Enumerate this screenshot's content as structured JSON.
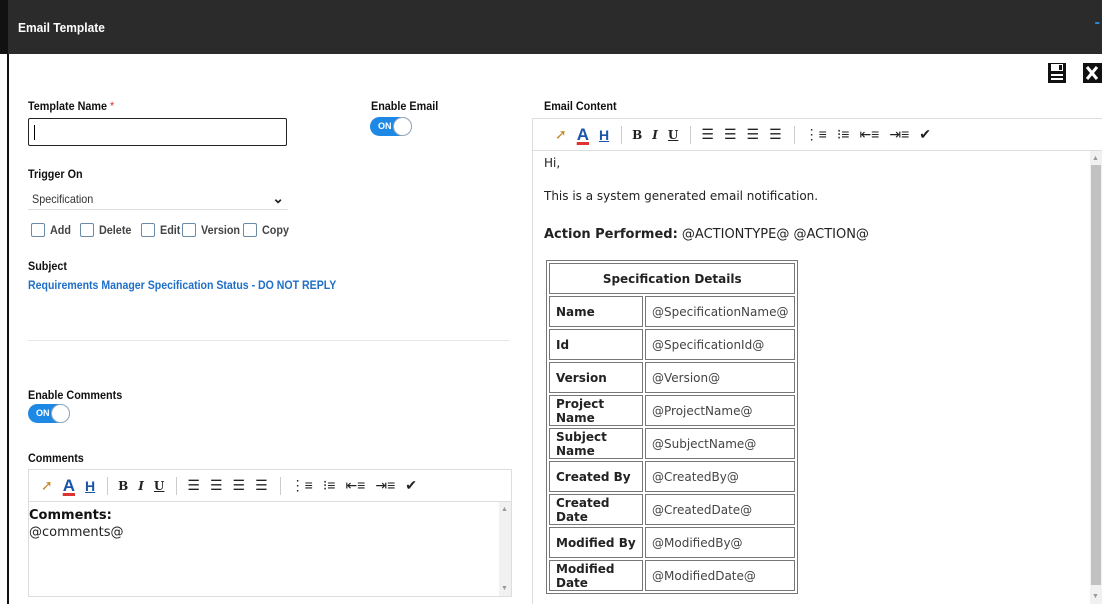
{
  "window": {
    "title": "Email Template",
    "minimize_glyph": "-"
  },
  "toolbar": {
    "save_icon": "save-icon",
    "close_icon": "close-icon"
  },
  "form": {
    "template_name_label": "Template Name",
    "required_mark": "*",
    "template_name_value": "",
    "enable_email_label": "Enable Email",
    "enable_email_state": "ON",
    "trigger_on_label": "Trigger On",
    "trigger_on_value": "Specification",
    "checkboxes": [
      {
        "label": "Add",
        "checked": false
      },
      {
        "label": "Delete",
        "checked": false
      },
      {
        "label": "Edit",
        "checked": false
      },
      {
        "label": "Version",
        "checked": false
      },
      {
        "label": "Copy",
        "checked": false
      }
    ],
    "subject_label": "Subject",
    "subject_value": "Requirements Manager Specification Status - DO NOT REPLY",
    "enable_comments_label": "Enable Comments",
    "enable_comments_state": "ON",
    "comments_label": "Comments",
    "comments_heading": "Comments:",
    "comments_body": "@comments@"
  },
  "email": {
    "content_label": "Email Content",
    "greeting": "Hi,",
    "line1": "This is a system generated email notification.",
    "action_label": "Action Performed:",
    "action_value": "@ACTIONTYPE@ @ACTION@",
    "table_title": "Specification Details",
    "rows": [
      {
        "key": "Name",
        "value": "@SpecificationName@"
      },
      {
        "key": "Id",
        "value": "@SpecificationId@"
      },
      {
        "key": "Version",
        "value": "@Version@"
      },
      {
        "key": "Project Name",
        "value": "@ProjectName@"
      },
      {
        "key": "Subject Name",
        "value": "@SubjectName@"
      },
      {
        "key": "Created By",
        "value": "@CreatedBy@"
      },
      {
        "key": "Created Date",
        "value": "@CreatedDate@"
      },
      {
        "key": "Modified By",
        "value": "@ModifiedBy@"
      },
      {
        "key": "Modified Date",
        "value": "@ModifiedDate@"
      }
    ]
  },
  "editor_toolbar": {
    "font_color": "A",
    "highlight": "H",
    "bold": "B",
    "italic": "I",
    "underline": "U"
  },
  "colors": {
    "accent": "#1e88e5",
    "titlebar": "#2b2b2b",
    "link": "#1e6fc8"
  }
}
